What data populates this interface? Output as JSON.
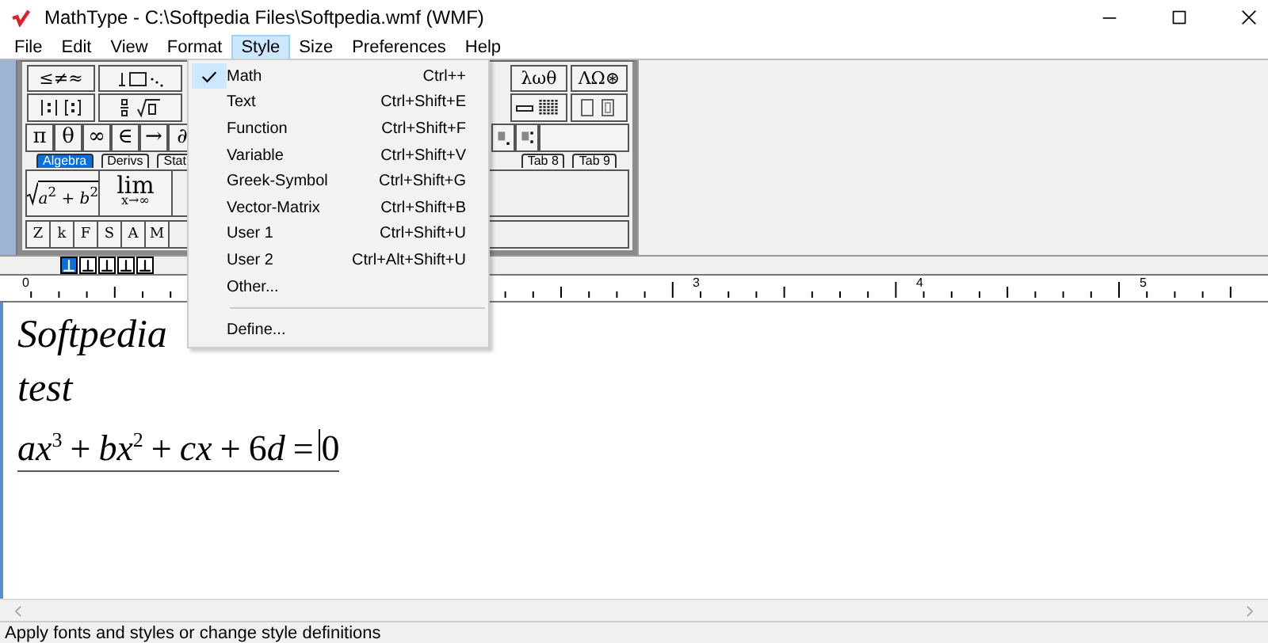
{
  "window": {
    "title": "MathType - C:\\Softpedia Files\\Softpedia.wmf (WMF)"
  },
  "menu_bar": [
    {
      "label": "File",
      "selected": false
    },
    {
      "label": "Edit",
      "selected": false
    },
    {
      "label": "View",
      "selected": false
    },
    {
      "label": "Format",
      "selected": false
    },
    {
      "label": "Style",
      "selected": true
    },
    {
      "label": "Size",
      "selected": false
    },
    {
      "label": "Preferences",
      "selected": false
    },
    {
      "label": "Help",
      "selected": false
    }
  ],
  "palette": {
    "row1_left": [
      "≤≠≈"
    ],
    "row1_right": [
      "λωθ",
      "ΛΩ⊛"
    ],
    "symbols": [
      "π",
      "θ",
      "∞",
      "∈",
      "→",
      "∂"
    ],
    "tabs": [
      {
        "label": "Algebra",
        "selected": true
      },
      {
        "label": "Derivs",
        "selected": false
      },
      {
        "label": "Stat",
        "selected": false
      }
    ],
    "tabs_right": [
      {
        "label": "Tab 8",
        "selected": false
      },
      {
        "label": "Tab 9",
        "selected": false
      }
    ],
    "letters": [
      "Z",
      "k",
      "F",
      "S",
      "A",
      "M"
    ],
    "templates": {
      "radicand": "*a*$^{2}$ + *b*$^{2}$",
      "limit": "lim",
      "limit_under": "x→∞"
    }
  },
  "tab_stops": [
    {
      "selected": true
    },
    {
      "selected": false
    },
    {
      "selected": false
    },
    {
      "selected": false
    },
    {
      "selected": false
    }
  ],
  "ruler": {
    "labels": [
      "0",
      "3",
      "4",
      "5"
    ]
  },
  "document": {
    "lines": [
      "Softpedia",
      "test"
    ],
    "equation": [
      {
        "kind": "var",
        "text": "ax"
      },
      {
        "kind": "sup",
        "text": "3"
      },
      {
        "kind": "op",
        "text": "+"
      },
      {
        "kind": "var",
        "text": "bx"
      },
      {
        "kind": "sup",
        "text": "2"
      },
      {
        "kind": "op",
        "text": "+"
      },
      {
        "kind": "var",
        "text": "cx"
      },
      {
        "kind": "op",
        "text": "+"
      },
      {
        "kind": "num",
        "text": "6"
      },
      {
        "kind": "var",
        "text": "d"
      },
      {
        "kind": "op",
        "text": "="
      },
      {
        "kind": "num",
        "text": "0"
      }
    ]
  },
  "style_menu": [
    {
      "kind": "item",
      "label": "Math",
      "shortcut": "Ctrl++",
      "checked": true
    },
    {
      "kind": "item",
      "label": "Text",
      "shortcut": "Ctrl+Shift+E",
      "checked": false
    },
    {
      "kind": "item",
      "label": "Function",
      "shortcut": "Ctrl+Shift+F",
      "checked": false
    },
    {
      "kind": "item",
      "label": "Variable",
      "shortcut": "Ctrl+Shift+V",
      "checked": false
    },
    {
      "kind": "item",
      "label": "Greek-Symbol",
      "shortcut": "Ctrl+Shift+G",
      "checked": false
    },
    {
      "kind": "item",
      "label": "Vector-Matrix",
      "shortcut": "Ctrl+Shift+B",
      "checked": false
    },
    {
      "kind": "item",
      "label": "User 1",
      "shortcut": "Ctrl+Shift+U",
      "checked": false
    },
    {
      "kind": "item",
      "label": "User 2",
      "shortcut": "Ctrl+Alt+Shift+U",
      "checked": false
    },
    {
      "kind": "item",
      "label": "Other...",
      "checked": false
    },
    {
      "kind": "separator"
    },
    {
      "kind": "item",
      "label": "Define...",
      "checked": false
    }
  ],
  "status_bar": "Apply fonts and styles or change style definitions"
}
